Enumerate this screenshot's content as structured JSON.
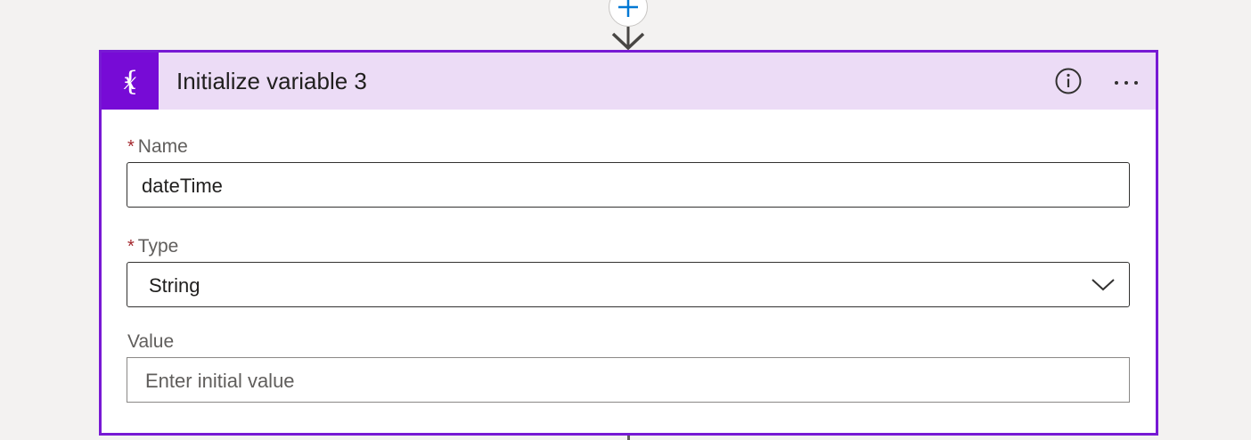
{
  "card": {
    "title": "Initialize variable 3",
    "icon": "variable-icon",
    "accent_color": "#770bd6",
    "header_bg": "#ecdcf6"
  },
  "fields": {
    "name": {
      "required_marker": "*",
      "label": "Name",
      "value": "dateTime"
    },
    "type": {
      "required_marker": "*",
      "label": "Type",
      "selected": "String"
    },
    "value": {
      "label": "Value",
      "placeholder": "Enter initial value"
    }
  },
  "icons": {
    "add_step": "plus-icon",
    "connector": "arrow-down-icon",
    "info": "info-icon",
    "more": "more-options-icon",
    "dropdown": "chevron-down-icon"
  }
}
